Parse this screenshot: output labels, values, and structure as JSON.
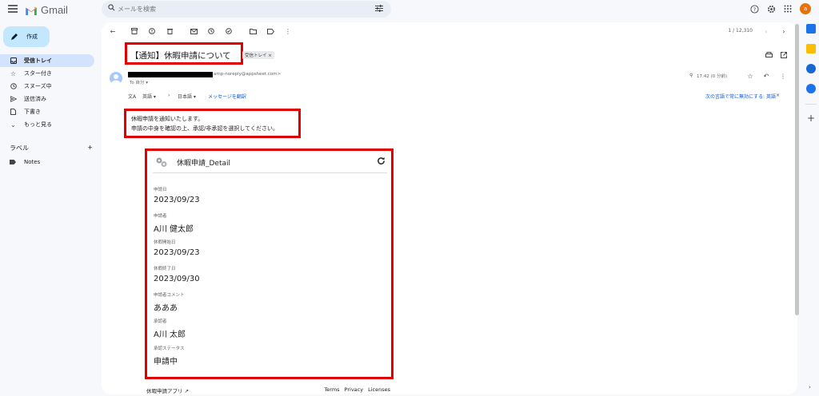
{
  "app": {
    "name": "Gmail"
  },
  "search": {
    "placeholder": "メールを検索"
  },
  "account": {
    "initial": "a"
  },
  "sidebar": {
    "compose_label": "作成",
    "items": [
      {
        "label": "受信トレイ",
        "icon": "inbox-icon"
      },
      {
        "label": "スター付き",
        "icon": "star-icon"
      },
      {
        "label": "スヌーズ中",
        "icon": "clock-icon"
      },
      {
        "label": "送信済み",
        "icon": "send-icon"
      },
      {
        "label": "下書き",
        "icon": "draft-icon"
      },
      {
        "label": "もっと見る",
        "icon": "chevron-down-icon"
      }
    ],
    "labels_heading": "ラベル",
    "labels": [
      {
        "label": "Notes",
        "icon": "label-icon"
      }
    ]
  },
  "toolbar": {
    "pager": "1 / 12,310"
  },
  "email": {
    "subject": "【通知】休暇申請について",
    "folder_chip": "受信トレイ ×",
    "sender_email": "amp-noreply@appsheet.com>",
    "to": "To 自分 ▾",
    "time": "17:42 (0 分前)",
    "translate": {
      "from": "英語 ▾",
      "arrow": "›",
      "to": "日本語 ▾",
      "action": "メッセージを翻訳",
      "never": "次の言語で常に無効にする: 英語"
    },
    "body_line1": "休暇申請を通知いたします。",
    "body_line2": "申請の中身を確認の上、承認/非承認を選択してください。"
  },
  "card": {
    "title": "休暇申請_Detail",
    "fields": [
      {
        "label": "申請日",
        "value": "2023/09/23"
      },
      {
        "label": "申請者",
        "value": "A川 健太郎"
      },
      {
        "label": "休暇開始日",
        "value": "2023/09/23"
      },
      {
        "label": "休暇終了日",
        "value": "2023/09/30"
      },
      {
        "label": "申請者コメント",
        "value": "あああ"
      },
      {
        "label": "承認者",
        "value": "A川 太郎"
      },
      {
        "label": "承認ステータス",
        "value": "申請中"
      }
    ],
    "footer_app": "休暇申請アプリ",
    "footer_links": [
      "Terms",
      "Privacy",
      "Licenses"
    ]
  },
  "colors": {
    "highlight": "#e00000",
    "accent": "#0b57d0",
    "compose": "#c2e7ff",
    "active_nav": "#d3e3fd"
  }
}
